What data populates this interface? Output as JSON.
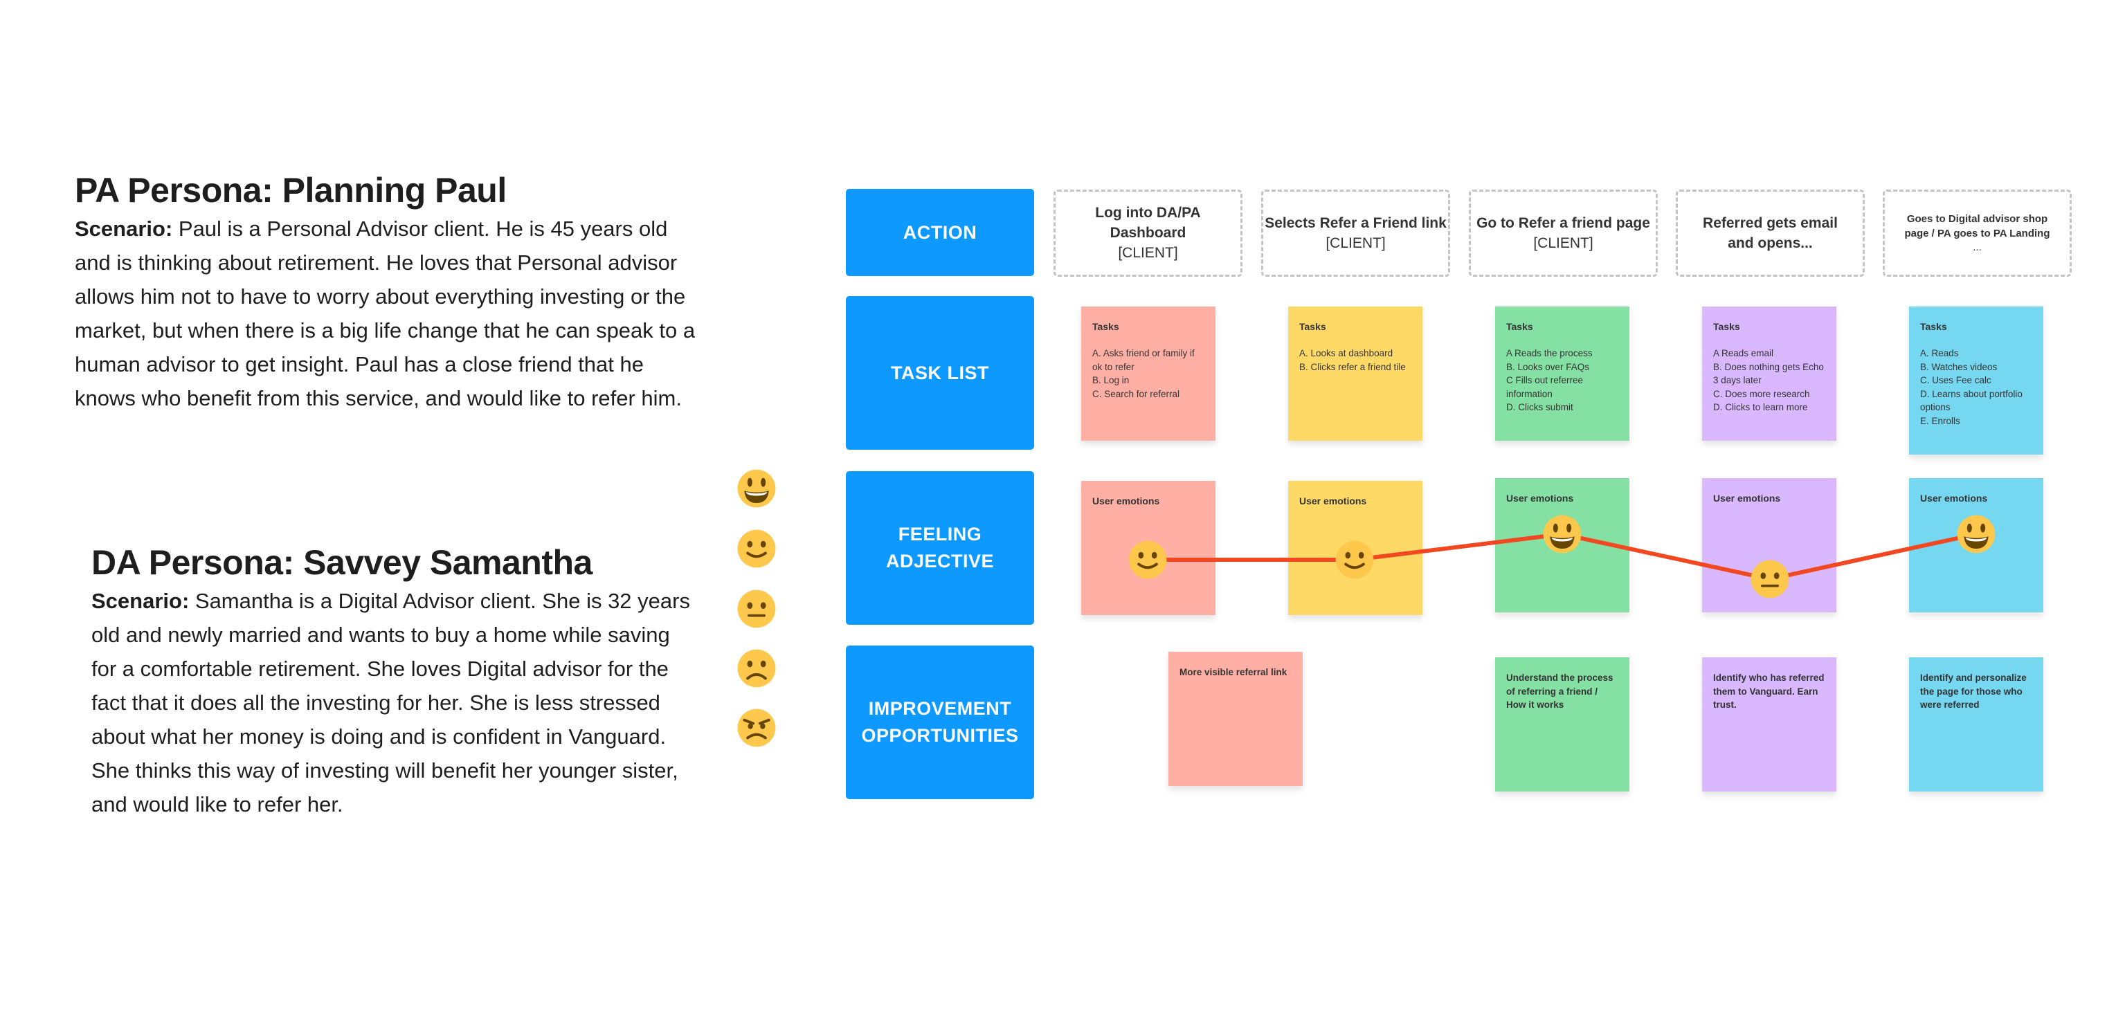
{
  "personas": [
    {
      "title": "PA Persona: Planning Paul",
      "scenario_label": "Scenario:",
      "scenario_text": " Paul is a Personal Advisor client. He is 45 years old and is thinking about retirement. He loves that Personal advisor allows him not to have to worry about everything investing or the market, but when there is a big life change that he can speak to a human advisor to get insight. Paul has a close friend that he knows who benefit from this service, and would like to refer him."
    },
    {
      "title": "DA Persona: Savvey Samantha",
      "scenario_label": "Scenario:",
      "scenario_text": " Samantha is a Digital Advisor client. She is 32 years old and newly married and wants to buy a home while saving for a comfortable retirement. She loves Digital advisor for the fact that it does all the investing for her. She is less stressed about what her money is doing and is confident in Vanguard. She thinks this way of investing will benefit her younger sister, and would like to refer her."
    }
  ],
  "emotion_scale": [
    "grinning-face",
    "slightly-smiling-face",
    "neutral-face",
    "slightly-frowning-face",
    "angry-face"
  ],
  "row_labels": {
    "action": "ACTION",
    "task_list": "TASK LIST",
    "feeling_line1": "FEELING",
    "feeling_line2": "ADJECTIVE",
    "improvement_line1": "IMPROVEMENT",
    "improvement_line2": "OPPORTUNITIES"
  },
  "colors": {
    "row_label": "#0d99ff",
    "line": "#f24822",
    "sticky_red": "#ffafa3",
    "sticky_yellow": "#ffd966",
    "sticky_green": "#85e0a3",
    "sticky_purple": "#d9b8ff",
    "sticky_cyan": "#75d7f0",
    "emoji_face": "#fdc84b",
    "emoji_feature": "#664500"
  },
  "steps": [
    {
      "action_title": "Log into DA/PA Dashboard",
      "action_sub": "[CLIENT]",
      "tasks_heading": "Tasks",
      "tasks": "A. Asks friend or family if\nok to refer\nB. Log in\nC. Search for referral",
      "emotion_heading": "User emotions",
      "emotion": "slightly-smiling-face",
      "improvement": "More visible referral link"
    },
    {
      "action_title": "Selects Refer a Friend link",
      "action_sub": "[CLIENT]",
      "tasks_heading": "Tasks",
      "tasks": "A. Looks at dashboard\nB. Clicks refer a friend tile",
      "emotion_heading": "User emotions",
      "emotion": "slightly-smiling-face",
      "improvement": ""
    },
    {
      "action_title": "Go to Refer a friend page",
      "action_sub": "[CLIENT]",
      "tasks_heading": "Tasks",
      "tasks": "A Reads the process\nB. Looks over FAQs\nC Fills out referree\ninformation\nD. Clicks submit",
      "emotion_heading": "User emotions",
      "emotion": "grinning-face",
      "improvement": "Understand the process of referring a friend / How it works"
    },
    {
      "action_title": "Referred gets email and opens...",
      "action_sub": "",
      "tasks_heading": "Tasks",
      "tasks": "A Reads email\nB. Does nothing gets Echo\n3 days later\nC. Does more research\nD. Clicks to learn more",
      "emotion_heading": "User emotions",
      "emotion": "neutral-face",
      "improvement": "Identify who has referred them to Vanguard. Earn trust."
    },
    {
      "action_title": "Goes to Digital advisor shop page / PA goes to PA Landing",
      "action_sub": "...",
      "tasks_heading": "Tasks",
      "tasks": "A. Reads\nB. Watches videos\nC. Uses Fee calc\nD. Learns about portfolio\noptions\nE. Enrolls",
      "emotion_heading": "User emotions",
      "emotion": "grinning-face",
      "improvement": "Identify and personalize the page for those who were referred"
    }
  ]
}
